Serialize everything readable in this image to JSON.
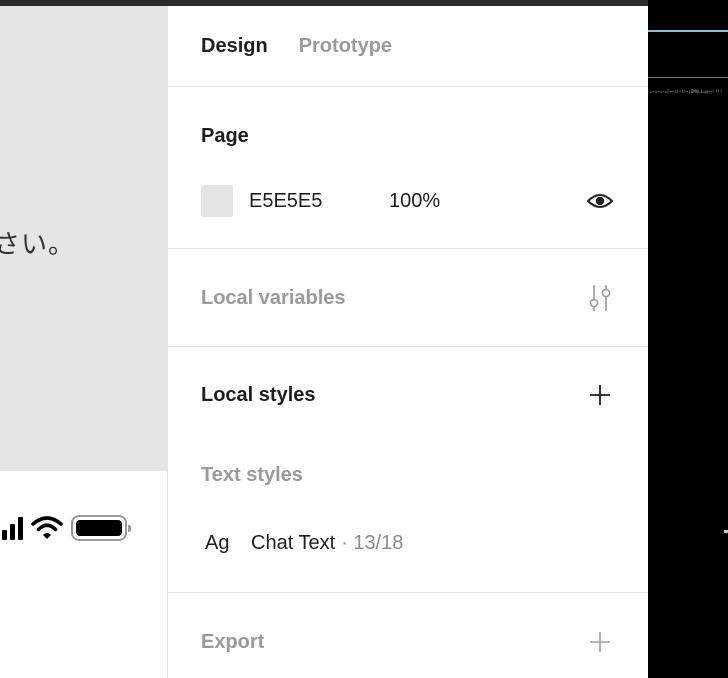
{
  "canvas": {
    "text": "さい。"
  },
  "panel": {
    "tabs": [
      {
        "label": "Design",
        "active": true
      },
      {
        "label": "Prototype",
        "active": false
      }
    ],
    "page": {
      "title": "Page",
      "color_hex": "E5E5E5",
      "opacity": "100%",
      "swatch_color": "#E5E5E5",
      "visibility_icon": "eye-icon"
    },
    "local_variables": {
      "title": "Local variables",
      "icon": "sliders-icon"
    },
    "local_styles": {
      "title": "Local styles",
      "add_icon": "plus-icon",
      "text_styles_label": "Text styles",
      "items": [
        {
          "preview": "Ag",
          "name": "Chat Text",
          "meta": "· 13/18"
        }
      ]
    },
    "export": {
      "title": "Export",
      "add_icon": "plus-icon"
    }
  },
  "dark_area": {
    "tiny_text": "=~=~=~=(~~)(!!!~)DMALL=@~~!!!!"
  },
  "colors": {
    "panel_bg": "#FFFFFF",
    "canvas_bg": "#E5E5E5",
    "text_primary": "#1E1E1E",
    "text_muted": "#9A9A9A",
    "dark_bg": "#000000"
  }
}
